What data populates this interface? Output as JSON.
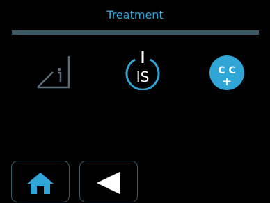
{
  "header": {
    "title": "Treatment"
  },
  "toolbar": {
    "items": [
      {
        "icon": "info-corner-icon"
      },
      {
        "icon": "is-power-icon",
        "label": "IS"
      },
      {
        "icon": "cc-plus-icon",
        "label_top": "C C",
        "label_bottom": "+"
      }
    ]
  },
  "nav": {
    "home_icon": "home-icon",
    "back_icon": "back-arrow-icon"
  },
  "colors": {
    "accent": "#2FA6D6",
    "bar": "#3C5A66",
    "icon_dim": "#5C6E78",
    "background": "#000000",
    "white": "#FFFFFF"
  }
}
